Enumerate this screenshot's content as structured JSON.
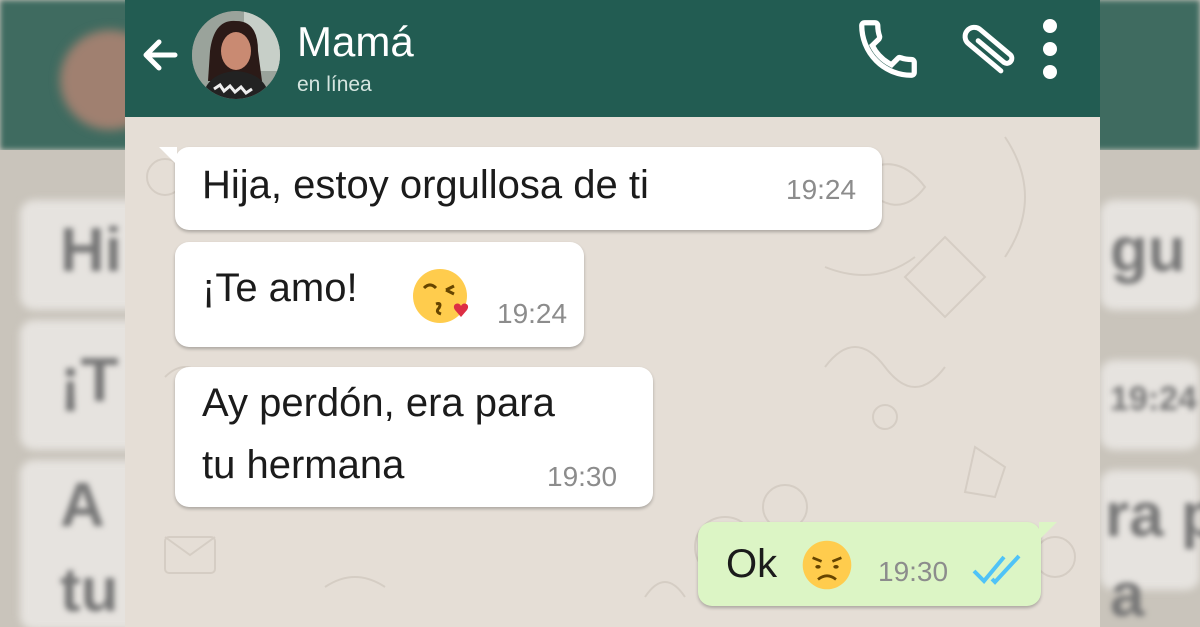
{
  "header": {
    "contact_name": "Mamá",
    "status": "en línea",
    "icons": [
      "back-arrow-icon",
      "avatar",
      "phone-icon",
      "paperclip-icon",
      "more-vert-icon"
    ]
  },
  "messages": [
    {
      "direction": "incoming",
      "text": "Hija, estoy orgullosa de ti",
      "time": "19:24"
    },
    {
      "direction": "incoming",
      "text": "¡Te amo!",
      "emoji": "kissing-heart-emoji",
      "time": "19:24"
    },
    {
      "direction": "incoming",
      "lines": [
        "Ay perdón, era para",
        "tu hermana"
      ],
      "time": "19:30"
    },
    {
      "direction": "outgoing",
      "text": "Ok",
      "emoji": "disappointed-face-emoji",
      "time": "19:30",
      "receipt": "double-check-read-icon"
    }
  ],
  "background": {
    "fragments": [
      "Hi",
      "¡T",
      "A",
      "tu",
      "gu",
      "19:24",
      "ra p",
      "a"
    ]
  },
  "colors": {
    "header": "#225c52",
    "chat_background": "#e5ded6",
    "incoming_bubble": "#ffffff",
    "outgoing_bubble": "#dcf5c5",
    "read_receipt": "#4fc3f7"
  }
}
